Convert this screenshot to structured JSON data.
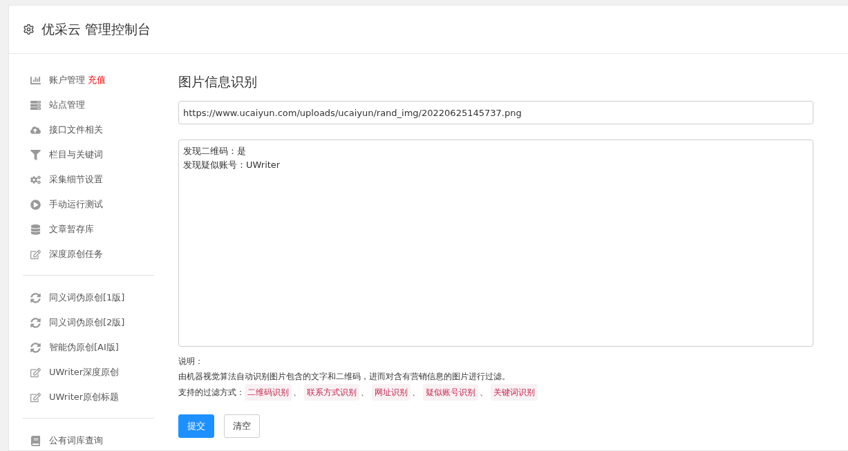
{
  "header": {
    "title": "优采云 管理控制台"
  },
  "sidebar": {
    "groups": [
      [
        {
          "kind": "chart",
          "label": "账户管理",
          "badge": "充值"
        },
        {
          "kind": "server",
          "label": "站点管理"
        },
        {
          "kind": "upload",
          "label": "接口文件相关"
        },
        {
          "kind": "filter",
          "label": "栏目与关键词"
        },
        {
          "kind": "cogs",
          "label": "采集细节设置"
        },
        {
          "kind": "play",
          "label": "手动运行测试"
        },
        {
          "kind": "database",
          "label": "文章暂存库"
        },
        {
          "kind": "edit",
          "label": "深度原创任务"
        }
      ],
      [
        {
          "kind": "sync",
          "label": "同义词伪原创[1版]"
        },
        {
          "kind": "sync",
          "label": "同义词伪原创[2版]"
        },
        {
          "kind": "sync",
          "label": "智能伪原创[AI版]"
        },
        {
          "kind": "edit",
          "label": "UWriter深度原创"
        },
        {
          "kind": "edit",
          "label": "UWriter原创标题"
        }
      ],
      [
        {
          "kind": "book",
          "label": "公有词库查询"
        }
      ]
    ]
  },
  "main": {
    "heading": "图片信息识别",
    "url_field": {
      "value": "https://www.ucaiyun.com/uploads/ucaiyun/rand_img/20220625145737.png"
    },
    "result_box": {
      "lines": [
        "发现二维码：是",
        "发现疑似账号：UWriter"
      ]
    },
    "notes": {
      "title": "说明：",
      "description": "由机器视觉算法自动识别图片包含的文字和二维码，进而对含有营销信息的图片进行过滤。",
      "filters_label": "支持的过滤方式：",
      "filter_tags": [
        "二维码识别",
        "联系方式识别",
        "网址识别",
        "疑似账号识别",
        "关键词识别"
      ],
      "separator": "、"
    },
    "buttons": [
      {
        "label": "提交",
        "kind": "primary"
      },
      {
        "label": "清空",
        "kind": "default"
      }
    ]
  }
}
